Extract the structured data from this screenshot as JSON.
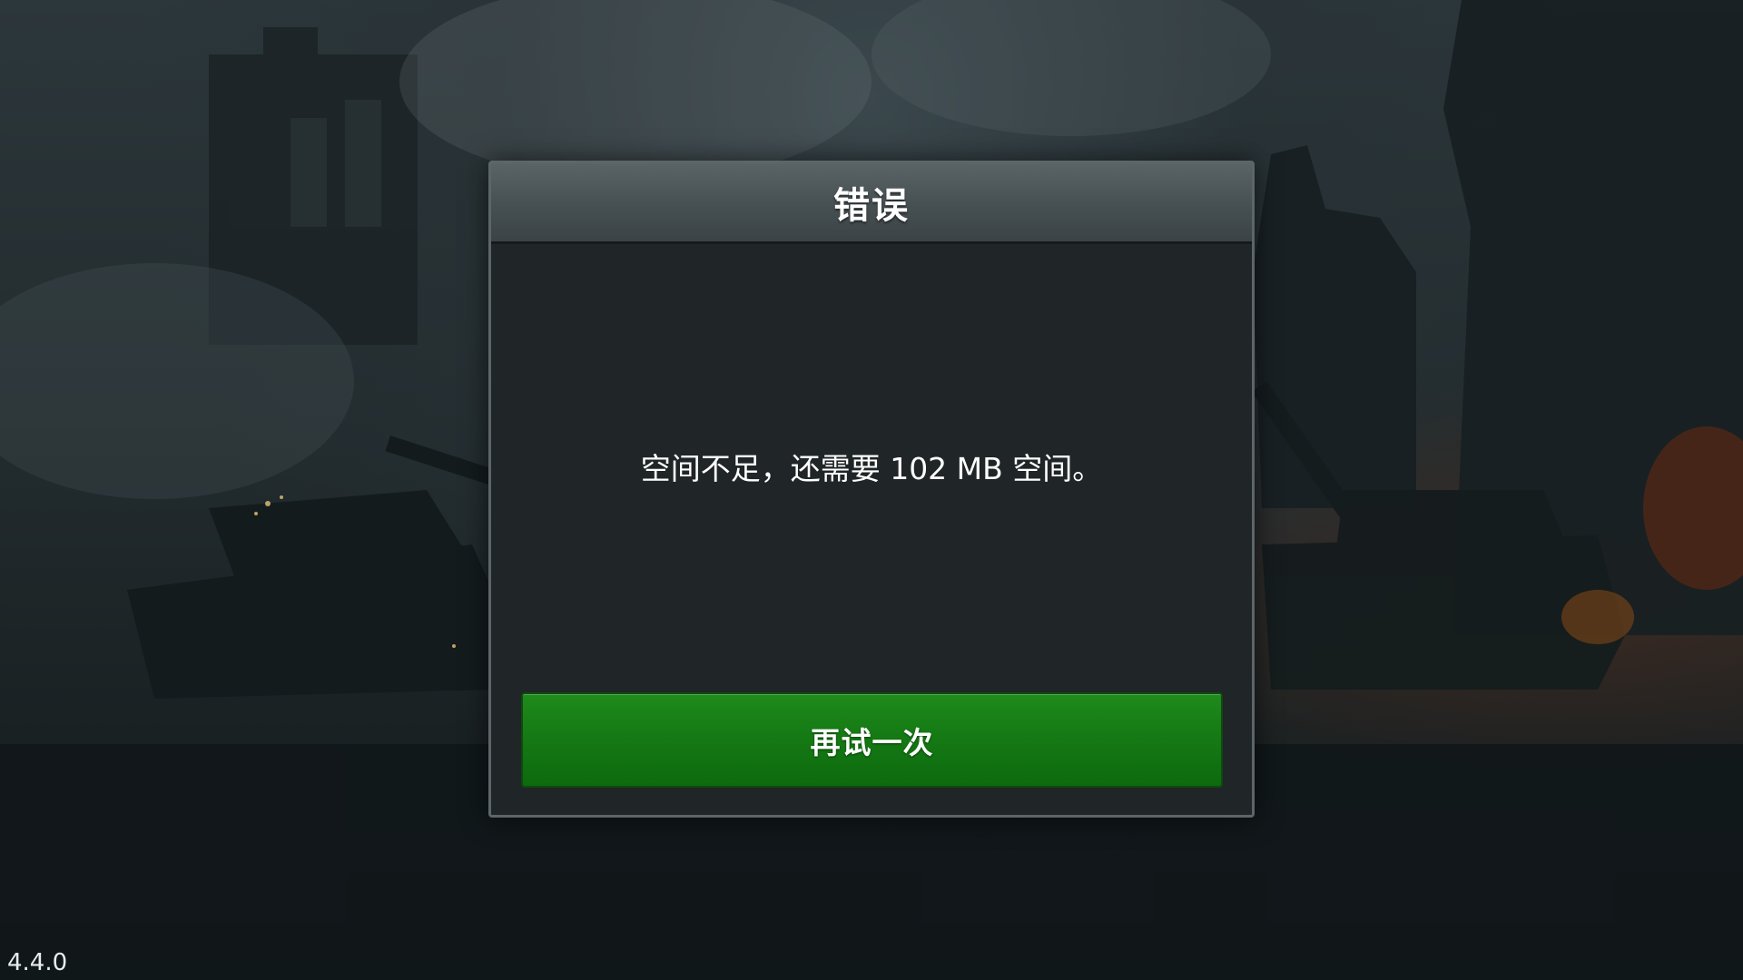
{
  "dialog": {
    "title": "错误",
    "message": "空间不足，还需要 102 MB 空间。",
    "retry_label": "再试一次",
    "accent_color": "#157a14"
  },
  "footer": {
    "version": "4.4.0"
  }
}
